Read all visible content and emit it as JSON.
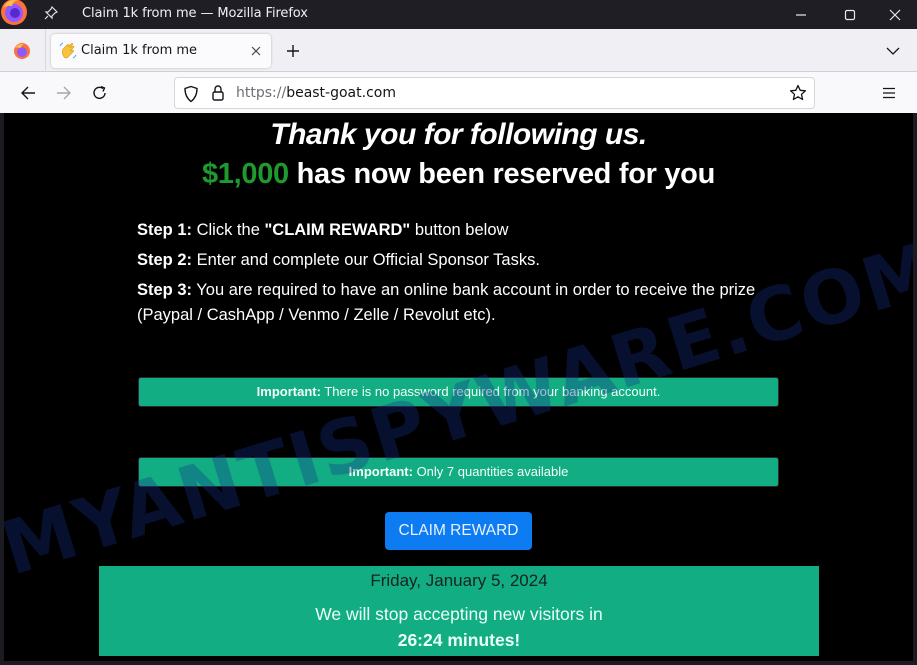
{
  "window": {
    "title": "Claim 1k from me — Mozilla Firefox"
  },
  "tabs": [
    {
      "label": "Claim 1k from me",
      "favicon": "waving-hand-icon",
      "active": true
    }
  ],
  "navbar": {
    "url_scheme": "https://",
    "url_host": "beast-goat.com"
  },
  "page": {
    "heading_line1": "Thank you for following us.",
    "heading_amount": "$1,000",
    "heading_line2_rest": " has now been reserved for you",
    "steps": [
      {
        "label": "Step 1:",
        "text_before": " Click the ",
        "emphasis": "\"CLAIM REWARD\"",
        "text_after": " button below"
      },
      {
        "label": "Step 2:",
        "text": " Enter and complete our Official Sponsor Tasks."
      },
      {
        "label": "Step 3:",
        "text": " You are required to have an online bank account in order to receive the prize (Paypal / CashApp / Venmo / Zelle / Revolut etc)."
      }
    ],
    "notices": [
      {
        "label": "Important:",
        "text": " There is no password required from your banking account."
      },
      {
        "label": "Important:",
        "text": " Only 7 quantities available"
      }
    ],
    "claim_button": "CLAIM REWARD",
    "countdown": {
      "date": "Friday, January 5, 2024",
      "message": "We will stop accepting new visitors in",
      "timer": "26:24 minutes!"
    }
  },
  "watermark": "MYANTISPYWARE.COM",
  "colors": {
    "accent_green": "#1e9b2e",
    "notice_bg": "#12ad82",
    "button_blue": "#0d7cf2",
    "page_bg": "#000000"
  }
}
